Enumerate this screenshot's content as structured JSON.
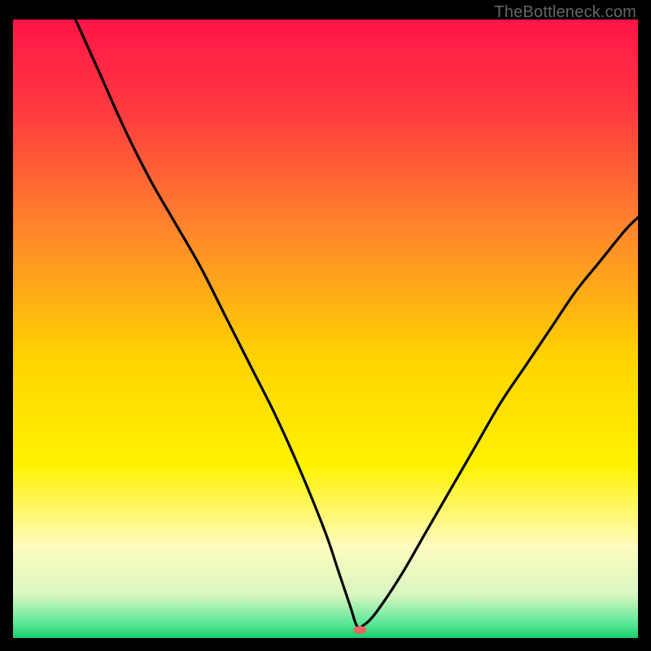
{
  "watermark": "TheBottleneck.com",
  "chart_data": {
    "type": "line",
    "title": "",
    "xlabel": "",
    "ylabel": "",
    "xlim": [
      0,
      100
    ],
    "ylim": [
      0,
      100
    ],
    "axes_visible": false,
    "grid": false,
    "background_gradient": {
      "stops": [
        {
          "offset": 0.0,
          "color": "#ff1447"
        },
        {
          "offset": 0.15,
          "color": "#ff3b3f"
        },
        {
          "offset": 0.35,
          "color": "#ff8a2a"
        },
        {
          "offset": 0.55,
          "color": "#ffd400"
        },
        {
          "offset": 0.72,
          "color": "#fff200"
        },
        {
          "offset": 0.85,
          "color": "#fffbbd"
        },
        {
          "offset": 0.93,
          "color": "#d8f7c0"
        },
        {
          "offset": 0.975,
          "color": "#5fe89a"
        },
        {
          "offset": 1.0,
          "color": "#18d06b"
        }
      ]
    },
    "series": [
      {
        "name": "bottleneck-curve",
        "x": [
          10,
          14,
          18,
          22,
          26,
          30,
          34,
          38,
          42,
          46,
          50,
          52,
          54,
          55,
          56,
          58,
          62,
          66,
          70,
          74,
          78,
          82,
          86,
          90,
          94,
          98,
          100
        ],
        "y": [
          100,
          91,
          82,
          74,
          67,
          60,
          52,
          44,
          36,
          27,
          17,
          11,
          5,
          2,
          2,
          4,
          10,
          17,
          24,
          31,
          38,
          44,
          50,
          56,
          61,
          66,
          68
        ]
      }
    ],
    "marker": {
      "x": 55.5,
      "y": 1.3,
      "color": "#e06860",
      "rx": 8,
      "ry": 5
    }
  }
}
